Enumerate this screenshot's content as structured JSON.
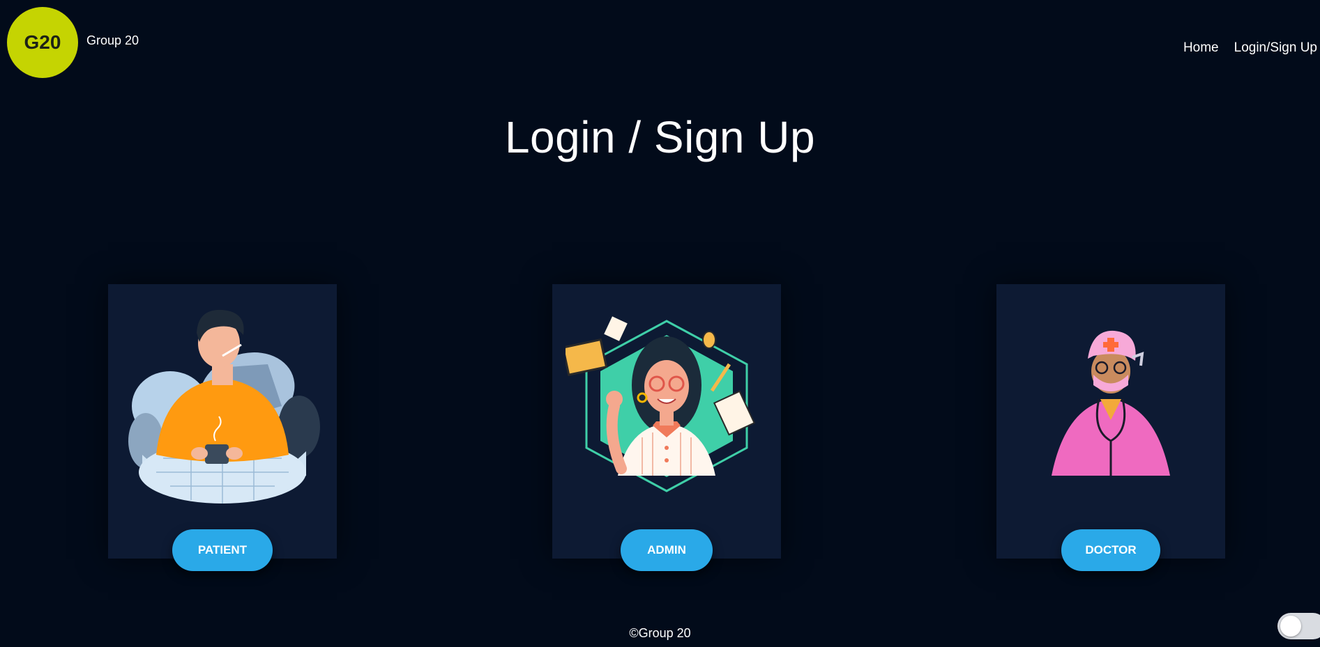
{
  "brand": {
    "logo_text": "G20",
    "name": "Group 20"
  },
  "nav": {
    "home": "Home",
    "login": "Login/Sign Up"
  },
  "page_title": "Login / Sign Up",
  "cards": [
    {
      "button": "PATIENT",
      "illustration": "sick-patient-illustration"
    },
    {
      "button": "ADMIN",
      "illustration": "admin-woman-illustration"
    },
    {
      "button": "DOCTOR",
      "illustration": "doctor-nurse-illustration"
    }
  ],
  "footer": "©Group 20",
  "colors": {
    "background": "#020b1a",
    "card": "#0d1a33",
    "accent_button": "#2aa9e8",
    "logo": "#c5d402"
  },
  "theme_toggle": {
    "state": "off"
  }
}
